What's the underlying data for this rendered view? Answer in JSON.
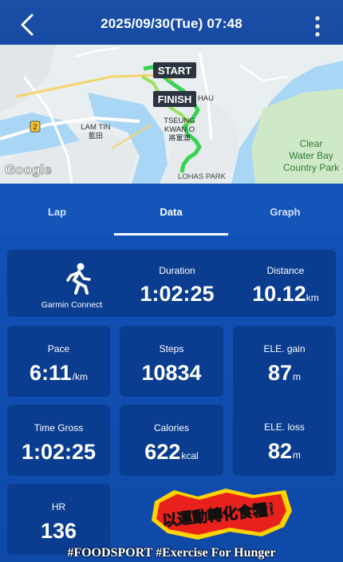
{
  "header": {
    "title": "2025/09/30(Tue) 07:48",
    "back_icon": "chevron-left-icon",
    "more_icon": "more-vertical-icon"
  },
  "map": {
    "start_label": "START",
    "finish_label": "FINISH",
    "places": {
      "lam_tin_en": "LAM TIN",
      "lam_tin_zh": "藍田",
      "tko_en_1": "TSEUNG",
      "tko_en_2": "KWAN O",
      "tko_zh": "將軍澳",
      "lohas_park": "LOHAS PARK",
      "clear_water_bay_1": "Clear",
      "clear_water_bay_2": "Water Bay",
      "clear_water_bay_3": "Country Park",
      "hau": "HAU",
      "route_2": "2"
    },
    "attribution": "Google"
  },
  "tabs": [
    {
      "label": "Lap",
      "active": false
    },
    {
      "label": "Data",
      "active": true
    },
    {
      "label": "Graph",
      "active": false
    }
  ],
  "stats": {
    "source": {
      "label": "Garmin Connect",
      "icon": "running-person-icon"
    },
    "duration": {
      "label": "Duration",
      "value": "1:02:25",
      "unit": ""
    },
    "distance": {
      "label": "Distance",
      "value": "10.12",
      "unit": "km"
    },
    "pace": {
      "label": "Pace",
      "value": "6:11",
      "unit": "/km"
    },
    "steps": {
      "label": "Steps",
      "value": "10834",
      "unit": ""
    },
    "ele_gain": {
      "label": "ELE. gain",
      "value": "87",
      "unit": "m"
    },
    "time_gross": {
      "label": "Time Gross",
      "value": "1:02:25",
      "unit": ""
    },
    "calories": {
      "label": "Calories",
      "value": "622",
      "unit": "kcal"
    },
    "ele_loss": {
      "label": "ELE. loss",
      "value": "82",
      "unit": "m"
    },
    "hr": {
      "label": "HR",
      "value": "136",
      "unit": ""
    }
  },
  "badge": {
    "text": "以運動轉化食糧！"
  },
  "footer": {
    "text": "#FOODSPORT #Exercise For Hunger"
  },
  "colors": {
    "background": "#1150b4",
    "card": "#0a3d8f",
    "route": "#39d353",
    "badge_red": "#e8211c",
    "badge_yellow": "#ffd400"
  }
}
